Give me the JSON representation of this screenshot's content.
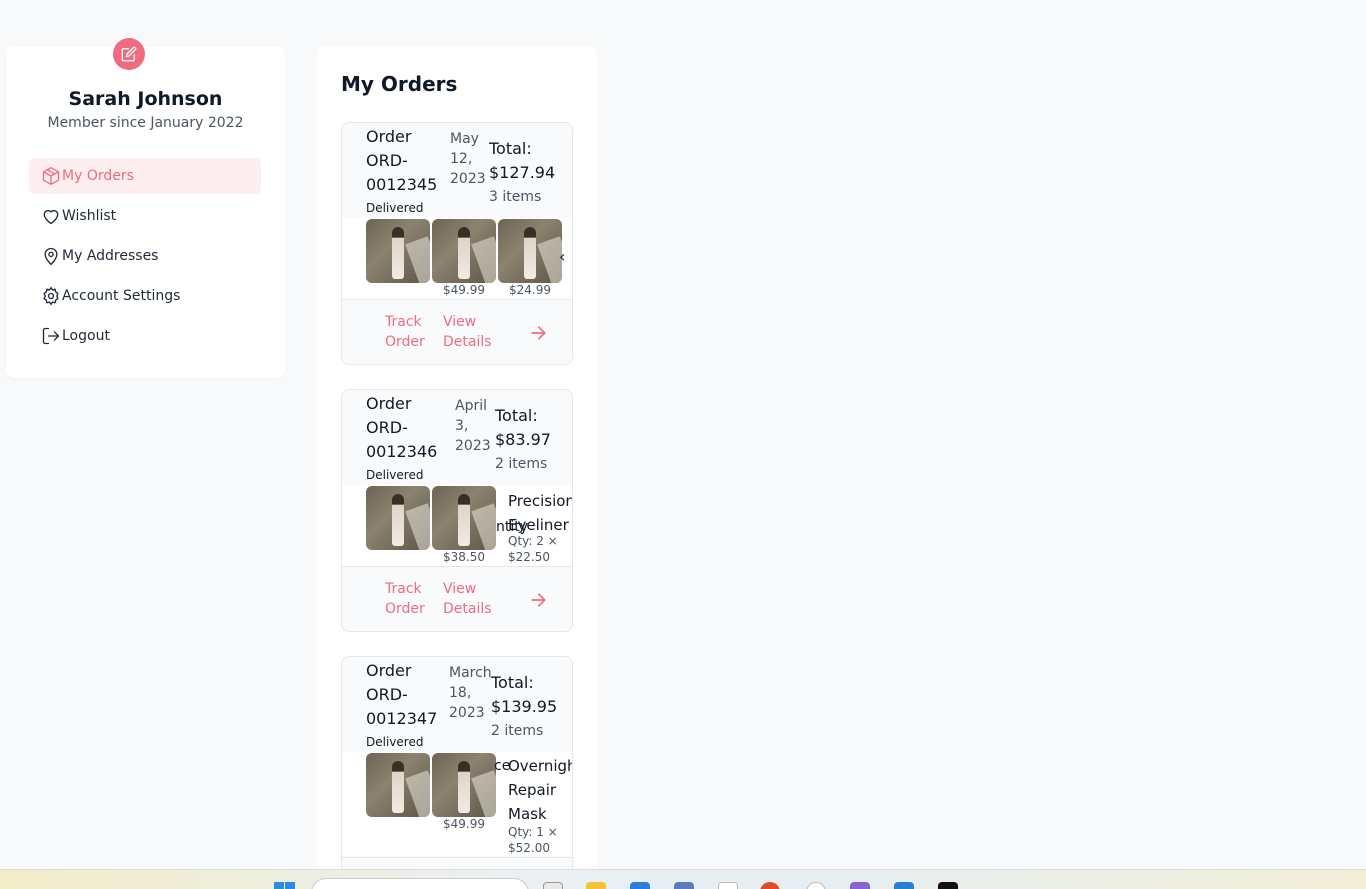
{
  "profile": {
    "name": "Sarah Johnson",
    "member_since": "Member since January 2022"
  },
  "nav": {
    "orders": "My Orders",
    "wishlist": "Wishlist",
    "addresses": "My Addresses",
    "settings": "Account Settings",
    "logout": "Logout"
  },
  "main": {
    "title": "My Orders"
  },
  "orders": [
    {
      "number": "Order ORD-0012345",
      "date": "May 12, 2023",
      "total": "Total: $127.94",
      "count": "3 items",
      "status": "Delivered",
      "prices": [
        "$49.99",
        "$24.99"
      ],
      "track": "Track Order",
      "details": "View Details"
    },
    {
      "number": "Order ORD-0012346",
      "date": "April 3, 2023",
      "total": "Total: $83.97",
      "count": "2 items",
      "status": "Delivered",
      "prices": [
        "$38.50"
      ],
      "peek_name": "Precision Eyeliner",
      "peek_qty": "Qty: 2 × $22.50",
      "peek_clip": "ntity",
      "track": "Track Order",
      "details": "View Details"
    },
    {
      "number": "Order ORD-0012347",
      "date": "March 18, 2023",
      "total": "Total: $139.95",
      "count": "2 items",
      "status": "Delivered",
      "prices": [
        "$49.99"
      ],
      "peek_name": "Overnight Repair Mask",
      "peek_qty": "Qty: 1 × $52.00",
      "peek_clip": "ce"
    }
  ],
  "colors": {
    "accent": "#f06b80",
    "active_bg": "#fdeef0"
  },
  "icons": [
    "edit-icon",
    "box-icon",
    "heart-icon",
    "map-pin-icon",
    "gear-icon",
    "logout-icon",
    "arrow-right-icon",
    "chevron-left-icon"
  ]
}
